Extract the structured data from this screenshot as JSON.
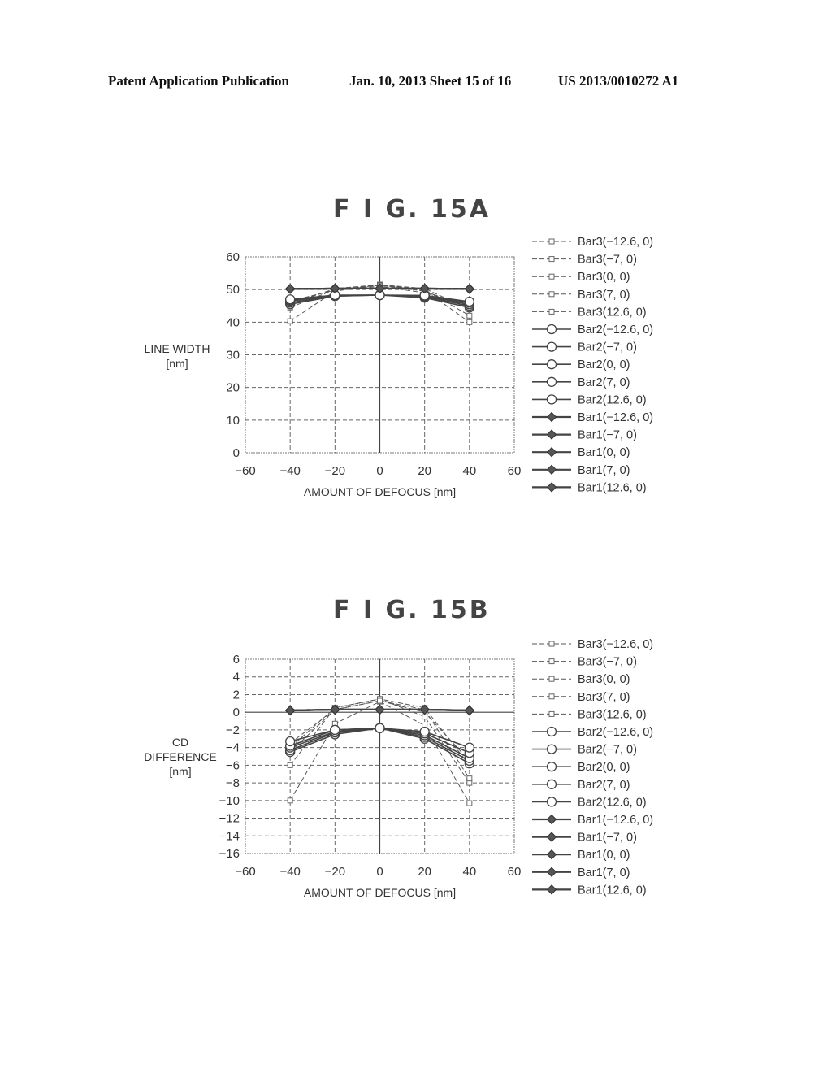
{
  "header": {
    "left": "Patent Application Publication",
    "middle": "Jan. 10, 2013  Sheet 15 of 16",
    "right": "US 2013/0010272 A1"
  },
  "legend_entries": [
    {
      "label": "Bar3(−12.6, 0)",
      "marker": "square",
      "line": "dashed"
    },
    {
      "label": "Bar3(−7, 0)",
      "marker": "square",
      "line": "dashed"
    },
    {
      "label": "Bar3(0, 0)",
      "marker": "square",
      "line": "dashed"
    },
    {
      "label": "Bar3(7, 0)",
      "marker": "square",
      "line": "dashed"
    },
    {
      "label": "Bar3(12.6, 0)",
      "marker": "square",
      "line": "dashed"
    },
    {
      "label": "Bar2(−12.6, 0)",
      "marker": "circle",
      "line": "solid"
    },
    {
      "label": "Bar2(−7, 0)",
      "marker": "circle",
      "line": "solid"
    },
    {
      "label": "Bar2(0, 0)",
      "marker": "circle",
      "line": "solid"
    },
    {
      "label": "Bar2(7, 0)",
      "marker": "circle",
      "line": "solid"
    },
    {
      "label": "Bar2(12.6, 0)",
      "marker": "circle",
      "line": "solid"
    },
    {
      "label": "Bar1(−12.6, 0)",
      "marker": "diamond",
      "line": "solid"
    },
    {
      "label": "Bar1(−7, 0)",
      "marker": "diamond",
      "line": "solid"
    },
    {
      "label": "Bar1(0, 0)",
      "marker": "diamond",
      "line": "solid"
    },
    {
      "label": "Bar1(7, 0)",
      "marker": "diamond",
      "line": "solid"
    },
    {
      "label": "Bar1(12.6, 0)",
      "marker": "diamond",
      "line": "solid"
    }
  ],
  "chart_data": [
    {
      "type": "line",
      "title": "F I G.  15A",
      "xlabel": "AMOUNT OF DEFOCUS [nm]",
      "ylabel": [
        "LINE WIDTH",
        "[nm]"
      ],
      "xlim": [
        -60,
        60
      ],
      "ylim": [
        0,
        60
      ],
      "xticks": [
        -60,
        -40,
        -20,
        0,
        20,
        40,
        60
      ],
      "yticks": [
        0,
        10,
        20,
        30,
        40,
        50,
        60
      ],
      "xtick_labels": [
        "−60",
        "−40",
        "−20",
        "0",
        "20",
        "40",
        "60"
      ],
      "ytick_labels": [
        "0",
        "10",
        "20",
        "30",
        "40",
        "50",
        "60"
      ],
      "grid": true,
      "legend": "right",
      "x": [
        -40,
        -20,
        0,
        20,
        40
      ],
      "series": [
        {
          "name": "Bar3(−12.6, 0)",
          "values": [
            40.3,
            49.5,
            51.5,
            49.8,
            40.0
          ]
        },
        {
          "name": "Bar3(−7, 0)",
          "values": [
            44.5,
            50.0,
            51.3,
            50.0,
            42.0
          ]
        },
        {
          "name": "Bar3(0, 0)",
          "values": [
            45.5,
            50.3,
            51.5,
            50.3,
            44.0
          ]
        },
        {
          "name": "Bar3(7, 0)",
          "values": [
            46.0,
            50.0,
            51.3,
            49.5,
            44.5
          ]
        },
        {
          "name": "Bar3(12.6, 0)",
          "values": [
            46.5,
            49.8,
            51.0,
            49.0,
            45.0
          ]
        },
        {
          "name": "Bar2(−12.6, 0)",
          "values": [
            45.5,
            48.0,
            48.3,
            47.5,
            44.5
          ]
        },
        {
          "name": "Bar2(−7, 0)",
          "values": [
            46.0,
            48.0,
            48.3,
            47.8,
            45.0
          ]
        },
        {
          "name": "Bar2(0, 0)",
          "values": [
            46.5,
            48.2,
            48.3,
            48.0,
            45.5
          ]
        },
        {
          "name": "Bar2(7, 0)",
          "values": [
            46.8,
            48.2,
            48.3,
            48.0,
            46.0
          ]
        },
        {
          "name": "Bar2(12.6, 0)",
          "values": [
            47.0,
            48.3,
            48.3,
            48.2,
            46.3
          ]
        },
        {
          "name": "Bar1(−12.6, 0)",
          "values": [
            50.2,
            50.3,
            50.3,
            50.3,
            50.2
          ]
        },
        {
          "name": "Bar1(−7, 0)",
          "values": [
            50.2,
            50.3,
            50.3,
            50.3,
            50.2
          ]
        },
        {
          "name": "Bar1(0, 0)",
          "values": [
            50.2,
            50.3,
            50.3,
            50.3,
            50.2
          ]
        },
        {
          "name": "Bar1(7, 0)",
          "values": [
            50.2,
            50.3,
            50.3,
            50.3,
            50.2
          ]
        },
        {
          "name": "Bar1(12.6, 0)",
          "values": [
            50.2,
            50.3,
            50.3,
            50.3,
            50.2
          ]
        }
      ]
    },
    {
      "type": "line",
      "title": "F I G.  15B",
      "xlabel": "AMOUNT OF DEFOCUS [nm]",
      "ylabel": [
        "CD",
        "DIFFERENCE",
        "[nm]"
      ],
      "xlim": [
        -60,
        60
      ],
      "ylim": [
        -16,
        6
      ],
      "xticks": [
        -60,
        -40,
        -20,
        0,
        20,
        40,
        60
      ],
      "yticks": [
        -16,
        -14,
        -12,
        -10,
        -8,
        -6,
        -4,
        -2,
        0,
        2,
        4,
        6
      ],
      "xtick_labels": [
        "−60",
        "−40",
        "−20",
        "0",
        "20",
        "40",
        "60"
      ],
      "ytick_labels": [
        "−16",
        "−14",
        "−12",
        "−10",
        "−8",
        "−6",
        "−4",
        "−2",
        "0",
        "2",
        "4",
        "6"
      ],
      "grid": true,
      "legend": "right",
      "x": [
        -40,
        -20,
        0,
        20,
        40
      ],
      "series": [
        {
          "name": "Bar3(−12.6, 0)",
          "values": [
            -10.0,
            -1.3,
            1.2,
            -1.5,
            -10.3
          ]
        },
        {
          "name": "Bar3(−7, 0)",
          "values": [
            -6.0,
            0.5,
            1.5,
            -0.5,
            -8.0
          ]
        },
        {
          "name": "Bar3(0, 0)",
          "values": [
            -4.5,
            0.3,
            1.3,
            0.3,
            -7.5
          ]
        },
        {
          "name": "Bar3(7, 0)",
          "values": [
            -4.0,
            0.5,
            1.5,
            0.5,
            -6.0
          ]
        },
        {
          "name": "Bar3(12.6, 0)",
          "values": [
            -3.5,
            0.3,
            1.3,
            0.0,
            -5.5
          ]
        },
        {
          "name": "Bar2(−12.6, 0)",
          "values": [
            -4.5,
            -2.5,
            -1.8,
            -3.0,
            -5.8
          ]
        },
        {
          "name": "Bar2(−7, 0)",
          "values": [
            -4.3,
            -2.3,
            -1.8,
            -2.8,
            -5.5
          ]
        },
        {
          "name": "Bar2(0, 0)",
          "values": [
            -4.0,
            -2.2,
            -1.8,
            -2.6,
            -5.2
          ]
        },
        {
          "name": "Bar2(7, 0)",
          "values": [
            -3.8,
            -2.0,
            -1.8,
            -2.4,
            -4.6
          ]
        },
        {
          "name": "Bar2(12.6, 0)",
          "values": [
            -3.3,
            -2.0,
            -1.8,
            -2.2,
            -4.0
          ]
        },
        {
          "name": "Bar1(−12.6, 0)",
          "values": [
            0.2,
            0.3,
            0.3,
            0.3,
            0.2
          ]
        },
        {
          "name": "Bar1(−7, 0)",
          "values": [
            0.2,
            0.3,
            0.3,
            0.3,
            0.2
          ]
        },
        {
          "name": "Bar1(0, 0)",
          "values": [
            0.2,
            0.3,
            0.3,
            0.3,
            0.2
          ]
        },
        {
          "name": "Bar1(7, 0)",
          "values": [
            0.2,
            0.3,
            0.3,
            0.3,
            0.2
          ]
        },
        {
          "name": "Bar1(12.6, 0)",
          "values": [
            0.2,
            0.3,
            0.3,
            0.3,
            0.2
          ]
        }
      ]
    }
  ]
}
